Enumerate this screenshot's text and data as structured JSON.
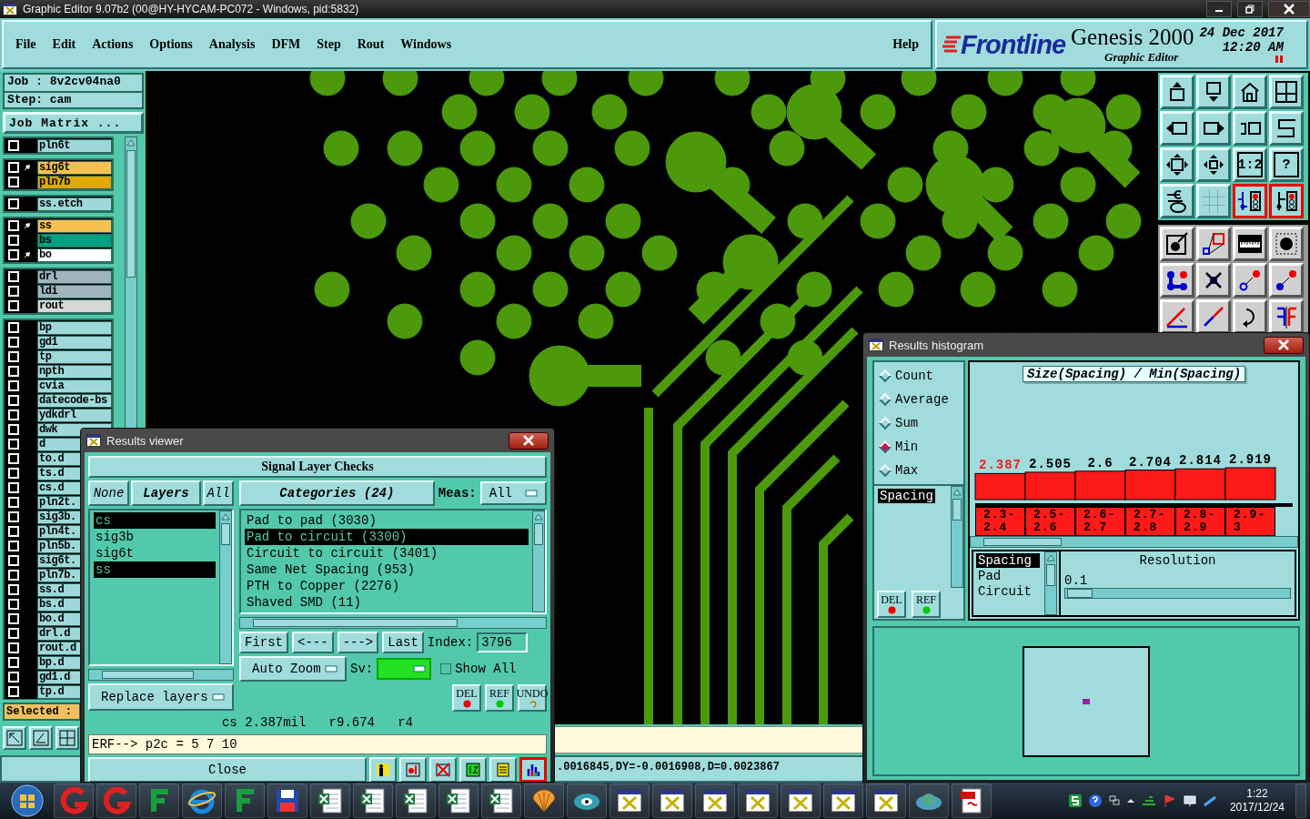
{
  "window": {
    "title": "Graphic Editor 9.07b2 (00@HY-HYCAM-PC072 - Windows, pid:5832)"
  },
  "menu": {
    "items": [
      "File",
      "Edit",
      "Actions",
      "Options",
      "Analysis",
      "DFM",
      "Step",
      "Rout",
      "Windows"
    ],
    "help": "Help"
  },
  "brand": {
    "logo": "Frontline",
    "product": "Genesis 2000",
    "subtitle": "Graphic Editor",
    "date": "24 Dec 2017",
    "time": "12:20 AM"
  },
  "job_panel": {
    "job": "Job : 8v2cv04na0",
    "step": "Step: cam",
    "matrix_button": "Job Matrix ...",
    "selected_label": "Selected :",
    "layer_groups": [
      {
        "layers": [
          {
            "name": "pln6t",
            "color": "#9ed8d8",
            "checked": false,
            "marked": false
          }
        ]
      },
      {
        "layers": [
          {
            "name": "sig6t",
            "color": "#f8c050",
            "checked": false,
            "marked": true
          },
          {
            "name": "pln7b",
            "color": "#e0a800",
            "checked": false,
            "marked": false
          }
        ]
      },
      {
        "layers": [
          {
            "name": "ss.etch",
            "color": "#9ed8d8",
            "checked": false,
            "marked": false
          }
        ]
      },
      {
        "layers": [
          {
            "name": "ss",
            "color": "#f8c050",
            "checked": false,
            "marked": true
          },
          {
            "name": "bs",
            "color": "#00a080",
            "checked": false,
            "marked": false
          },
          {
            "name": "bo",
            "color": "#ffffff",
            "checked": false,
            "marked": true
          }
        ]
      },
      {
        "layers": [
          {
            "name": "drl",
            "color": "#9fb4bd",
            "checked": false,
            "marked": false
          },
          {
            "name": "ldi",
            "color": "#9fb4bd",
            "checked": false,
            "marked": false
          },
          {
            "name": "rout",
            "color": "#d6d6d6",
            "checked": false,
            "marked": false
          }
        ]
      },
      {
        "layers": [
          {
            "name": "bp",
            "color": "#9ed8d8",
            "checked": false,
            "marked": false
          },
          {
            "name": "gd1",
            "color": "#9ed8d8",
            "checked": false,
            "marked": false
          },
          {
            "name": "tp",
            "color": "#9ed8d8",
            "checked": false,
            "marked": false
          },
          {
            "name": "npth",
            "color": "#9ed8d8",
            "checked": false,
            "marked": false
          },
          {
            "name": "cvia",
            "color": "#9ed8d8",
            "checked": false,
            "marked": false
          },
          {
            "name": "datecode-bs",
            "color": "#9ed8d8",
            "checked": false,
            "marked": false
          },
          {
            "name": "ydkdrl",
            "color": "#9ed8d8",
            "checked": false,
            "marked": false
          },
          {
            "name": "dwk",
            "color": "#9ed8d8",
            "checked": false,
            "marked": false
          },
          {
            "name": "d",
            "color": "#9ed8d8",
            "checked": false,
            "marked": false
          },
          {
            "name": "to.d",
            "color": "#9ed8d8",
            "checked": false,
            "marked": false
          },
          {
            "name": "ts.d",
            "color": "#9ed8d8",
            "checked": false,
            "marked": false
          },
          {
            "name": "cs.d",
            "color": "#9ed8d8",
            "checked": false,
            "marked": false
          },
          {
            "name": "pln2t.",
            "color": "#9ed8d8",
            "checked": false,
            "marked": false
          },
          {
            "name": "sig3b.",
            "color": "#9ed8d8",
            "checked": false,
            "marked": false
          },
          {
            "name": "pln4t.",
            "color": "#9ed8d8",
            "checked": false,
            "marked": false
          },
          {
            "name": "pln5b.",
            "color": "#9ed8d8",
            "checked": false,
            "marked": false
          },
          {
            "name": "sig6t.",
            "color": "#9ed8d8",
            "checked": false,
            "marked": false
          },
          {
            "name": "pln7b.",
            "color": "#9ed8d8",
            "checked": false,
            "marked": false
          },
          {
            "name": "ss.d",
            "color": "#9ed8d8",
            "checked": false,
            "marked": false
          },
          {
            "name": "bs.d",
            "color": "#9ed8d8",
            "checked": false,
            "marked": false
          },
          {
            "name": "bo.d",
            "color": "#9ed8d8",
            "checked": false,
            "marked": false
          },
          {
            "name": "drl.d",
            "color": "#9ed8d8",
            "checked": false,
            "marked": false
          },
          {
            "name": "rout.d",
            "color": "#9ed8d8",
            "checked": false,
            "marked": false
          },
          {
            "name": "bp.d",
            "color": "#9ed8d8",
            "checked": false,
            "marked": false
          },
          {
            "name": "gd1.d",
            "color": "#9ed8d8",
            "checked": false,
            "marked": false
          },
          {
            "name": "tp.d",
            "color": "#9ed8d8",
            "checked": false,
            "marked": false
          }
        ]
      }
    ]
  },
  "toolbar": {
    "tools": [
      {
        "active": false
      },
      {
        "active": false
      },
      {
        "active": false
      },
      {
        "active": false
      },
      {
        "active": false
      },
      {
        "active": false
      },
      {
        "active": false
      },
      {
        "active": false
      },
      {
        "active": false
      },
      {
        "active": false
      },
      {
        "label": "1:2",
        "active": false
      },
      {
        "label": "?",
        "active": false
      },
      {
        "active": false
      },
      {
        "active": false
      },
      {
        "active": true
      },
      {
        "active": true
      },
      {
        "active": false
      },
      {
        "active": false
      },
      {
        "active": false
      },
      {
        "active": false
      },
      {
        "active": false
      },
      {
        "active": false
      },
      {
        "active": false
      },
      {
        "active": false
      },
      {
        "active": false
      },
      {
        "active": false
      },
      {
        "active": false
      },
      {
        "active": false
      }
    ]
  },
  "results_viewer": {
    "title": "Results viewer",
    "header": "Signal Layer Checks",
    "none_button": "None",
    "layers_button": "Layers",
    "all_button": "All",
    "layers": [
      {
        "name": "cs",
        "selected": true
      },
      {
        "name": "sig3b",
        "selected": false
      },
      {
        "name": "sig6t",
        "selected": false
      },
      {
        "name": "ss",
        "selected": true
      }
    ],
    "categories_button": "Categories (24)",
    "meas_label": "Meas:",
    "meas_value": "All",
    "categories": [
      {
        "label": "Pad to pad (3030)",
        "selected": false
      },
      {
        "label": "Pad to circuit (3300)",
        "selected": true
      },
      {
        "label": "Circuit to circuit (3401)",
        "selected": false
      },
      {
        "label": "Same Net Spacing (953)",
        "selected": false
      },
      {
        "label": "PTH to Copper (2276)",
        "selected": false
      },
      {
        "label": "Shaved SMD (11)",
        "selected": false
      }
    ],
    "first_button": "First",
    "prev_button": "<---",
    "next_button": "--->",
    "last_button": "Last",
    "index_label": "Index:",
    "index_value": "3796",
    "zoom_mode": "Auto Zoom",
    "sv_label": "Sv:",
    "show_all": {
      "label": "Show All",
      "checked": false
    },
    "replace_mode": "Replace layers",
    "del_button": "DEL",
    "ref_button": "REF",
    "undo_button": "UNDO",
    "result": "cs 2.387mil   r9.674   r4",
    "erf_line": "ERF--> p2c = 5 7 10",
    "close_button": "Close",
    "histogram_active": true
  },
  "histogram": {
    "title": "Results histogram",
    "modes": [
      {
        "label": "Count",
        "selected": false
      },
      {
        "label": "Average",
        "selected": false
      },
      {
        "label": "Sum",
        "selected": false
      },
      {
        "label": "Min",
        "selected": true
      },
      {
        "label": "Max",
        "selected": false
      }
    ],
    "measures": [
      {
        "label": "Spacing",
        "selected": true
      }
    ],
    "del_button": "DEL",
    "ref_button": "REF",
    "chart_data": {
      "type": "bar",
      "title": "Size(Spacing) / Min(Spacing)",
      "categories": [
        "2.3-2.4",
        "2.5-2.6",
        "2.6-2.7",
        "2.7-2.8",
        "2.8-2.9",
        "2.9-3"
      ],
      "values": [
        2.387,
        2.505,
        2.6,
        2.704,
        2.814,
        2.919
      ],
      "data_labels": true
    },
    "groups": [
      {
        "label": "Spacing",
        "selected": true
      },
      {
        "label": "Pad",
        "selected": false
      },
      {
        "label": "Circuit",
        "selected": false
      }
    ],
    "resolution_label": "Resolution",
    "resolution_value": "0.1",
    "resolution_slider": {
      "level": 0
    }
  },
  "status_bar": {
    "coordinates": ".0016845,DY=-0.0016908,D=0.0023867"
  },
  "taskbar": {
    "time": "1:22",
    "date": "2017/12/24"
  }
}
